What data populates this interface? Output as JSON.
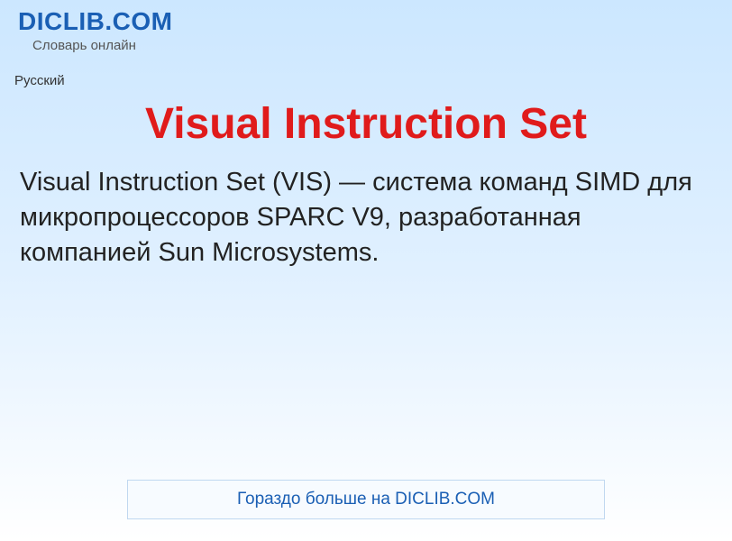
{
  "header": {
    "site_name": "DICLIB.COM",
    "tagline": "Словарь онлайн"
  },
  "language": "Русский",
  "article": {
    "title": "Visual Instruction Set",
    "body": "Visual Instruction Set (VIS) — система команд SIMD для микропроцессоров SPARC V9, разработанная компанией Sun Microsystems."
  },
  "footer": {
    "link_text": "Гораздо больше на DICLIB.COM"
  }
}
